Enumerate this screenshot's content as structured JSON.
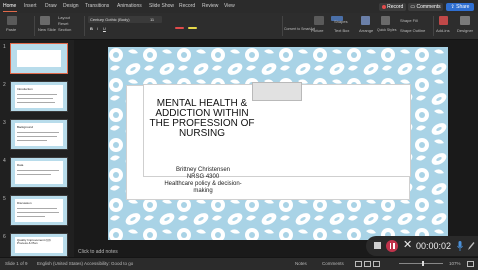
{
  "menu": {
    "tabs": [
      "Home",
      "Insert",
      "Draw",
      "Design",
      "Transitions",
      "Animations",
      "Slide Show",
      "Record",
      "Review",
      "View"
    ],
    "record_label": "Record",
    "comments_label": "Comments",
    "share_label": "Share"
  },
  "ribbon": {
    "paste": "Paste",
    "new_slide": "New Slide",
    "layout": "Layout",
    "reset": "Reset",
    "section": "Section",
    "font_name": "Century Gothic (Body)",
    "font_size": "11",
    "picture": "Picture",
    "text_box": "Text Box",
    "shapes": "Shapes",
    "arrange": "Arrange",
    "quick_styles": "Quick Styles",
    "shape_fill": "Shape Fill",
    "shape_outline": "Shape Outline",
    "convert_smartart": "Convert to SmartArt",
    "add_ins": "Add-ins",
    "designer": "Designer"
  },
  "thumbnails": [
    {
      "num": "1",
      "title": "",
      "selected": true
    },
    {
      "num": "2",
      "title": "Introduction"
    },
    {
      "num": "3",
      "title": "Background"
    },
    {
      "num": "4",
      "title": "Data"
    },
    {
      "num": "5",
      "title": "Discussion"
    },
    {
      "num": "6",
      "title": "Quality Improvement (QI) Process & Plan"
    }
  ],
  "slide": {
    "title": "MENTAL HEALTH & ADDICTION WITHIN THE PROFESSION OF NURSING",
    "author": "Brittney Christensen",
    "course": "NRSG 4300",
    "subject_line1": "Healthcare policy & decision-",
    "subject_line2": "making"
  },
  "notes_placeholder": "Click to add notes",
  "recorder": {
    "timer": "00:00:02"
  },
  "status": {
    "slide_counter": "Slide 1 of 9",
    "language": "English (United States)",
    "accessibility": "Accessibility: Good to go",
    "notes": "Notes",
    "comments": "Comments",
    "zoom": "107%"
  },
  "colors": {
    "accent": "#e0694a",
    "record_red": "#c0334b",
    "slide_pattern_bg": "#a9d3e6"
  }
}
